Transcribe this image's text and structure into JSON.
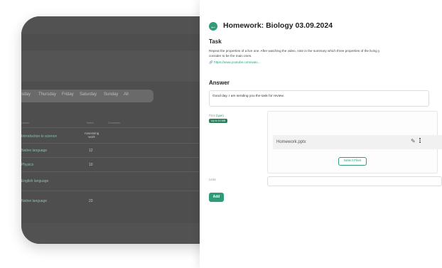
{
  "background": {
    "days": [
      "esday",
      "Thursday",
      "Friday",
      "Saturday",
      "Sunday",
      "All"
    ],
    "table_headers": [
      "Lesson",
      "Status",
      "Comments"
    ],
    "rows": [
      {
        "lesson": "Introduction to science",
        "status": "Assessing work"
      },
      {
        "lesson": "Native language",
        "status": "12"
      },
      {
        "lesson": "Physics",
        "status": "10"
      },
      {
        "lesson": "English language",
        "status": ""
      },
      {
        "lesson": "Native language",
        "status": "23"
      }
    ]
  },
  "panel": {
    "title": "Homework: Biology 03.09.2024",
    "back_icon": "arrow-left-icon",
    "task_heading": "Task",
    "task_text_line1": "Repeat the properties of a live one. After watching the video, note in the summary which three properties of the living y",
    "task_text_line2": "consider to be the main ones.",
    "task_link": "https://www.youtube.com/watc...",
    "answer_heading": "Answer",
    "answer_text": "Good day. I am sending you the task for review.",
    "files_label": "Files",
    "files_type": "(type)",
    "files_badge": "Up to 10 MB",
    "file_name": "Homework.pptx",
    "select_files_label": "Select Files",
    "links_label": "Links",
    "add_label": "Add"
  },
  "colors": {
    "accent": "#2e9c78",
    "overlay": "#4e4e4e"
  }
}
